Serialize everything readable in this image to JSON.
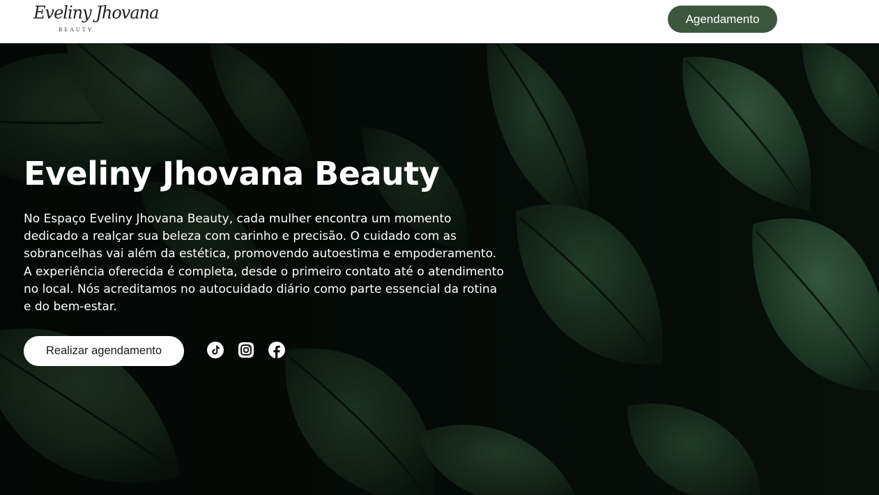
{
  "header": {
    "logo_script": "Eveliny Jhovana",
    "logo_sub": "BEAUTY",
    "cta_label": "Agendamento"
  },
  "hero": {
    "title": "Eveliny Jhovana Beauty",
    "description": "No Espaço Eveliny Jhovana Beauty, cada mulher encontra um momento dedicado a realçar sua beleza com carinho e precisão. O cuidado com as sobrancelhas vai além da estética, promovendo autoestima e empoderamento. A experiência oferecida é completa, desde o primeiro contato até o atendimento no local. Nós acreditamos no autocuidado diário como parte essencial da rotina e do bem-estar.",
    "cta_label": "Realizar agendamento",
    "social": [
      {
        "icon": "tiktok-icon"
      },
      {
        "icon": "instagram-icon"
      },
      {
        "icon": "facebook-icon"
      }
    ]
  },
  "colors": {
    "accent_green": "#3d573f",
    "hero_background": "#0a130e",
    "leaf": "#1f3a27"
  }
}
